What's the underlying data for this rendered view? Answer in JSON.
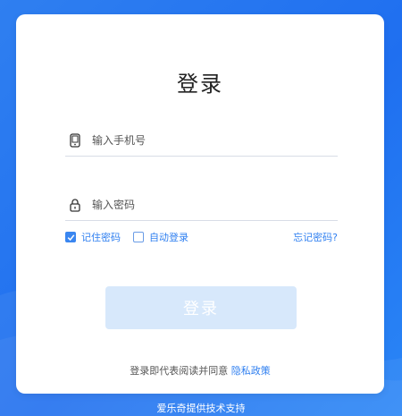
{
  "login": {
    "title": "登录",
    "phone_placeholder": "输入手机号",
    "password_placeholder": "输入密码",
    "remember_label": "记住密码",
    "remember_checked": true,
    "auto_login_label": "自动登录",
    "auto_login_checked": false,
    "forgot_label": "忘记密码?",
    "submit_label": "登录",
    "agreement_prefix": "登录即代表阅读并同意",
    "privacy_link": "隐私政策"
  },
  "footer": {
    "support_text": "爱乐奇提供技术支持"
  },
  "colors": {
    "accent": "#2f7ff0",
    "button_disabled": "#d7e8fb",
    "background": "#2477f0"
  },
  "icons": {
    "phone": "phone-icon",
    "lock": "lock-icon",
    "check": "check-icon"
  }
}
